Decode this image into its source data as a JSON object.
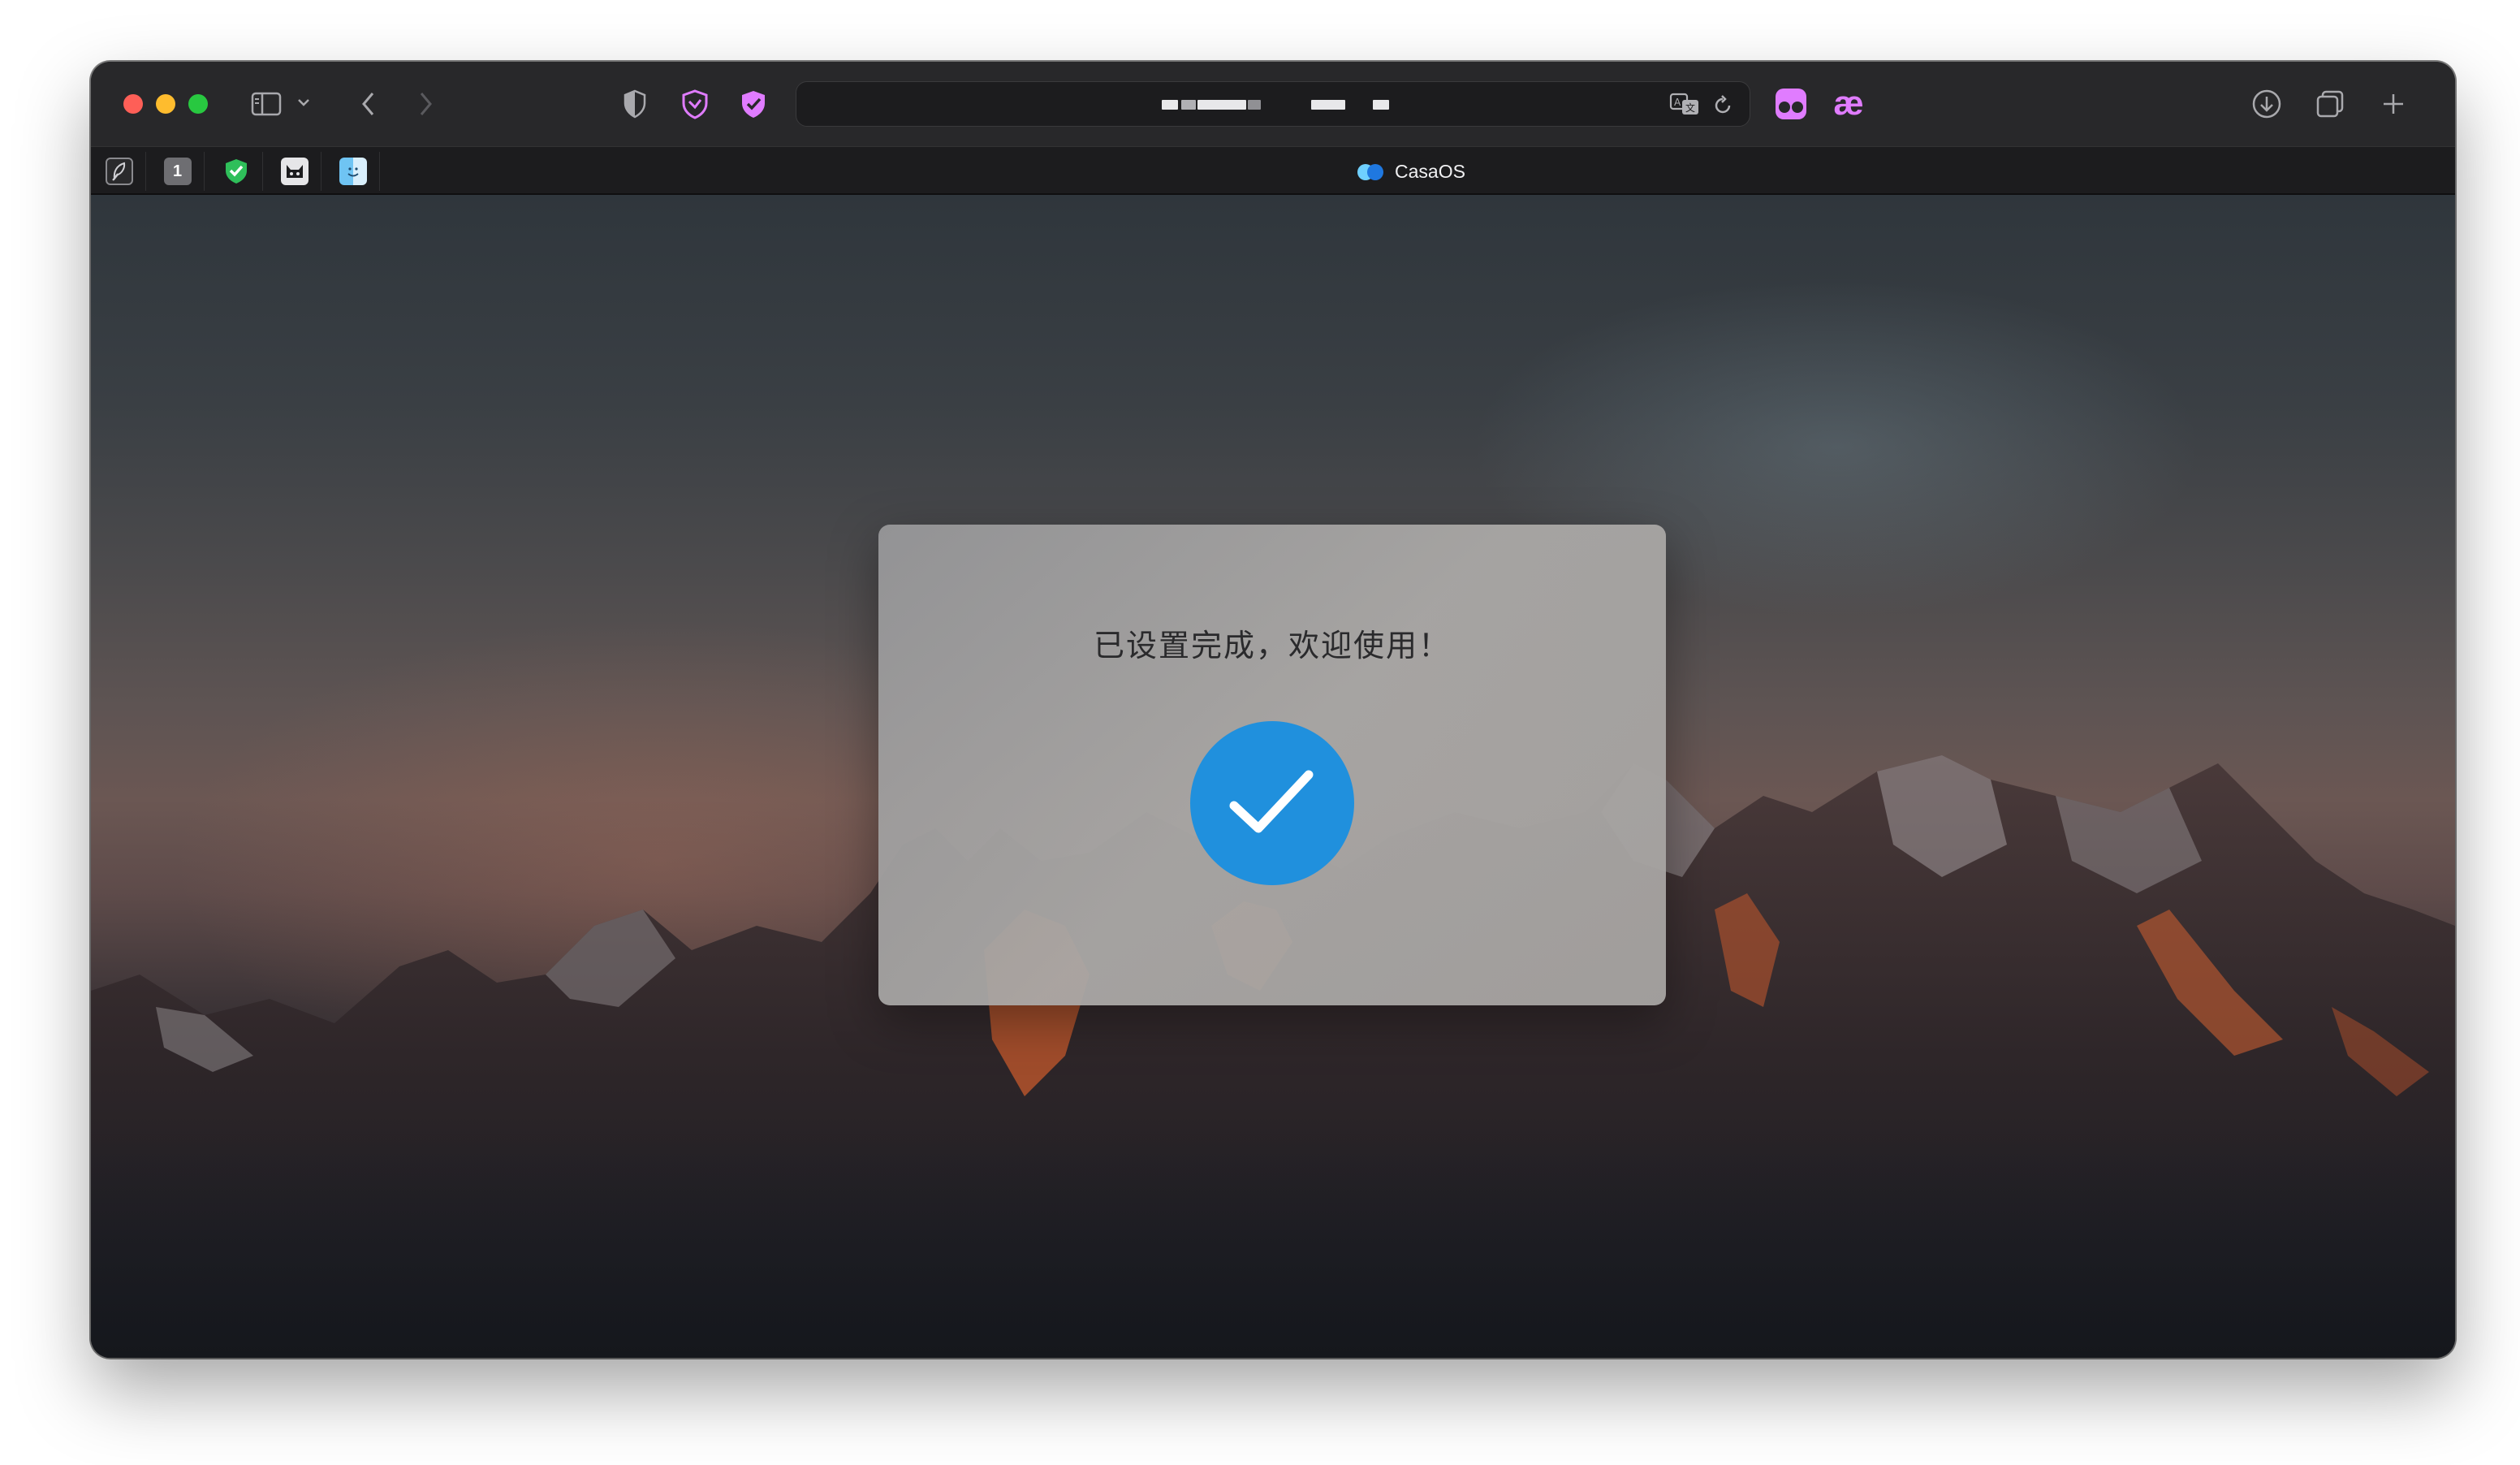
{
  "browser": {
    "tabs": [
      {
        "label": "CasaOS",
        "active": true
      }
    ],
    "pinned_tabs": [
      {
        "icon": "feather-icon"
      },
      {
        "icon": "one-password-icon",
        "text": "1"
      },
      {
        "icon": "green-shield-icon"
      },
      {
        "icon": "cat-face-icon"
      },
      {
        "icon": "finder-icon"
      }
    ],
    "toolbar_icons": [
      "sidebar-icon",
      "chevron-down-icon",
      "back-icon",
      "forward-icon",
      "shield-icon",
      "heart-shield-icon",
      "purple-shield-icon",
      "translate-icon",
      "reload-icon",
      "extension-mask-icon",
      "ae-ligature-icon",
      "download-icon",
      "tabs-overview-icon",
      "new-tab-icon"
    ],
    "ae_label": "æ"
  },
  "dialog": {
    "title": "已设置完成，欢迎使用！",
    "check_color": "#2090dd"
  },
  "colors": {
    "traffic_close": "#fe5f57",
    "traffic_min": "#febc2e",
    "traffic_max": "#28c840",
    "accent_purple": "#e07cff"
  }
}
